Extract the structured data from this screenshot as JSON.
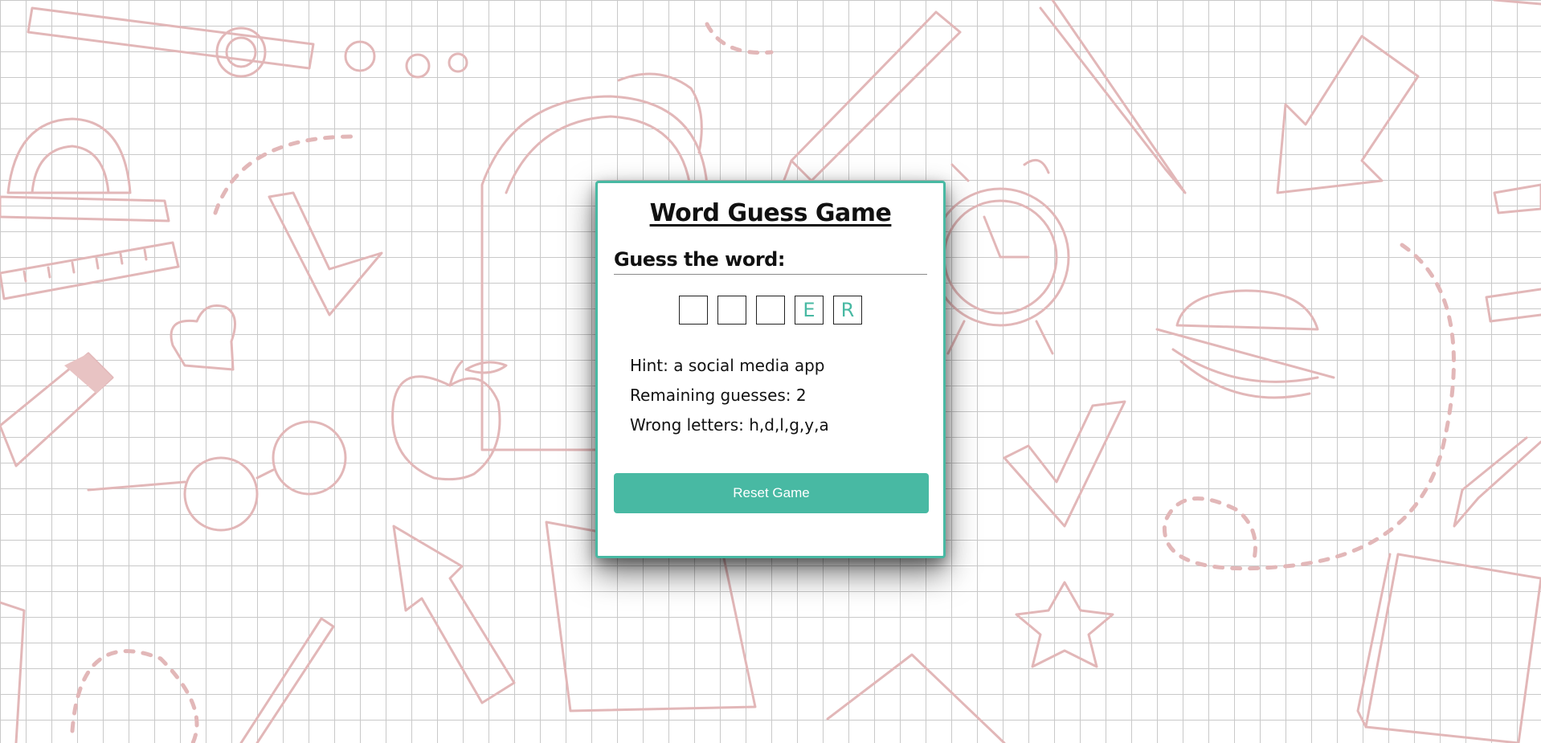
{
  "game": {
    "title": "Word Guess Game",
    "subtitle": "Guess the word:",
    "letters": [
      "",
      "",
      "",
      "E",
      "R"
    ],
    "hint": "Hint: a social media app",
    "remaining": "Remaining guesses: 2",
    "wrong": "Wrong letters: h,d,l,g,y,a",
    "reset_label": "Reset Game"
  },
  "colors": {
    "accent": "#48b9a3",
    "background": "#ffffff",
    "grid_lines": "#c9c9c9",
    "doodle_lines": "#e2b7b8"
  },
  "icons": [
    "school-supplies-doodle-background"
  ]
}
